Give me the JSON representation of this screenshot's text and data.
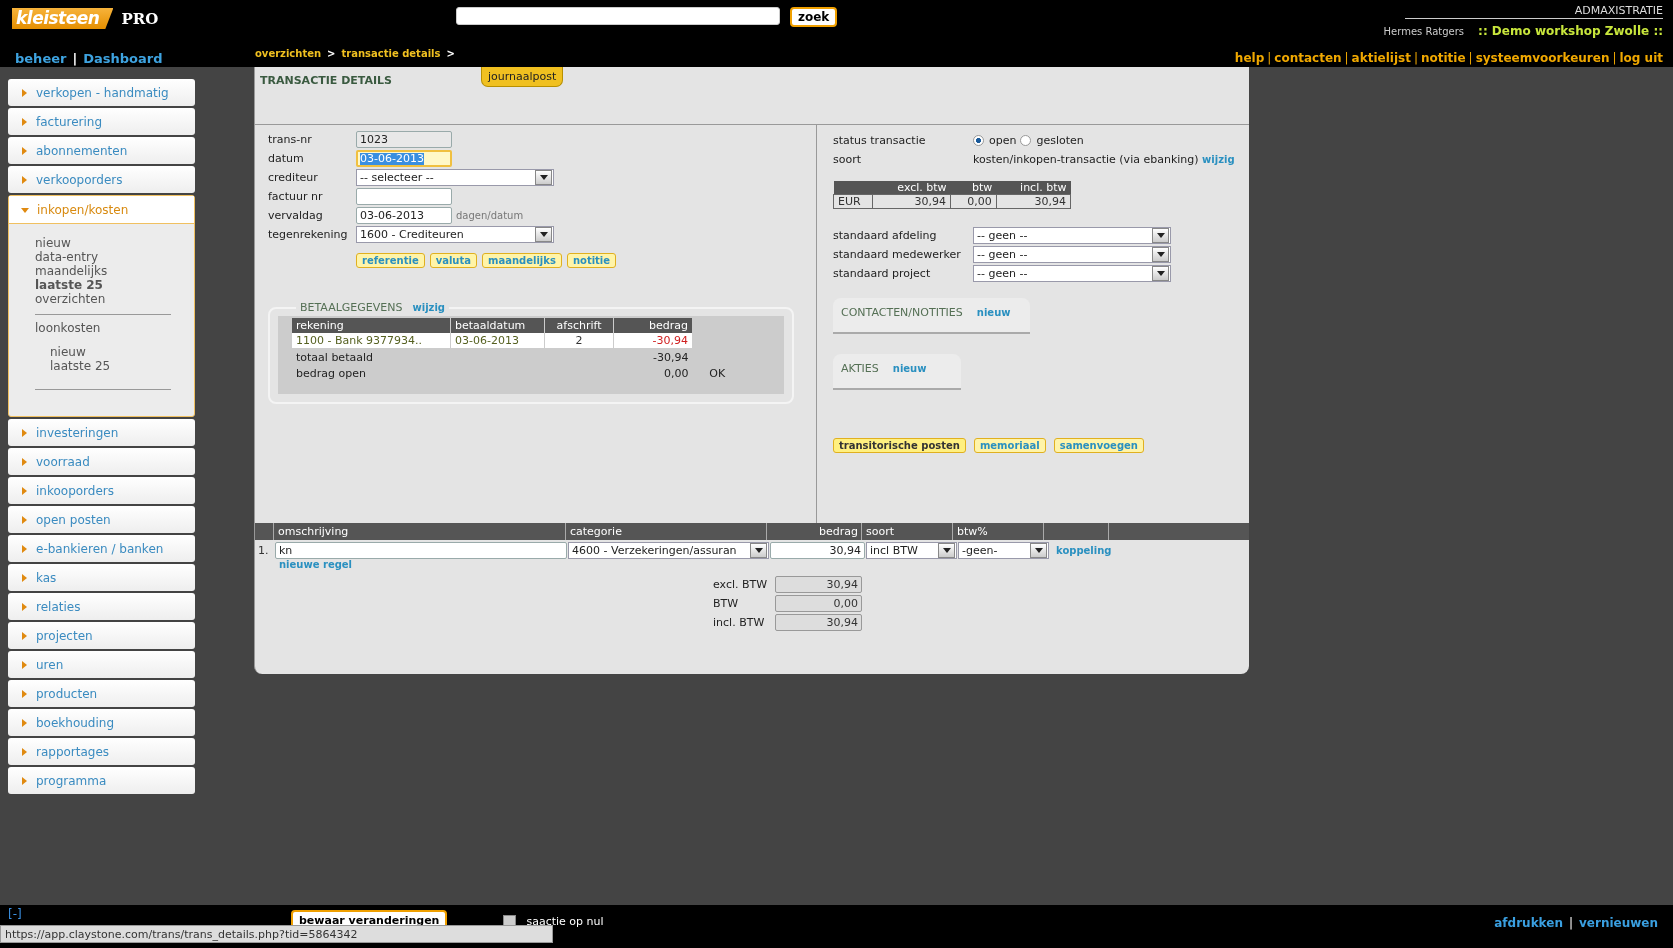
{
  "header": {
    "logo": "kleisteen",
    "edition": "PRO",
    "search": {
      "button": "zoek"
    },
    "app_name": "ADMAXISTRATIE",
    "user": "Hermes Ratgers",
    "company": ":: Demo workshop Zwolle ::",
    "left_links": [
      "beheer",
      "Dashboard"
    ],
    "link_separator": "|",
    "breadcrumb": [
      "overzichten",
      "transactie details"
    ],
    "breadcrumb_separator": ">",
    "top_links": [
      "help",
      "contacten",
      "aktielijst",
      "notitie",
      "systeemvoorkeuren",
      "log uit"
    ]
  },
  "sidebar": {
    "items": [
      {
        "label": "verkopen - handmatig",
        "expanded": false
      },
      {
        "label": "facturering",
        "expanded": false
      },
      {
        "label": "abonnementen",
        "expanded": false
      },
      {
        "label": "verkooporders",
        "expanded": false
      },
      {
        "label": "inkopen/kosten",
        "expanded": true,
        "children": [
          {
            "label": "nieuw",
            "selected": false
          },
          {
            "label": "data-entry",
            "selected": false
          },
          {
            "label": "maandelijks",
            "selected": false
          },
          {
            "label": "laatste 25",
            "selected": true
          },
          {
            "label": "overzichten",
            "selected": false
          },
          {
            "label": "loonkosten",
            "selected": false,
            "children": [
              {
                "label": "nieuw",
                "selected": false
              },
              {
                "label": "laatste 25",
                "selected": false
              }
            ]
          }
        ]
      },
      {
        "label": "investeringen",
        "expanded": false
      },
      {
        "label": "voorraad",
        "expanded": false
      },
      {
        "label": "inkooporders",
        "expanded": false
      },
      {
        "label": "open posten",
        "expanded": false
      },
      {
        "label": "e-bankieren / banken",
        "expanded": false
      },
      {
        "label": "kas",
        "expanded": false
      },
      {
        "label": "relaties",
        "expanded": false
      },
      {
        "label": "projecten",
        "expanded": false
      },
      {
        "label": "uren",
        "expanded": false
      },
      {
        "label": "producten",
        "expanded": false
      },
      {
        "label": "boekhouding",
        "expanded": false
      },
      {
        "label": "rapportages",
        "expanded": false
      },
      {
        "label": "programma",
        "expanded": false
      }
    ]
  },
  "main": {
    "title": "TRANSACTIE DETAILS",
    "tab": "journaalpost",
    "fields": [
      {
        "label": "trans-nr",
        "kind": "input",
        "value": "1023",
        "disabled": true,
        "focused": false
      },
      {
        "label": "datum",
        "kind": "input",
        "value": "03-06-2013",
        "disabled": false,
        "focused": true
      },
      {
        "label": "crediteur",
        "kind": "select",
        "value": "-- selecteer --",
        "disabled": false,
        "focused": false
      },
      {
        "label": "factuur nr",
        "kind": "input",
        "disabled": false,
        "focused": false
      },
      {
        "label": "vervaldag",
        "kind": "input",
        "value": "03-06-2013",
        "hint": "dagen/datum",
        "disabled": false,
        "focused": false
      },
      {
        "label": "tegenrekening",
        "kind": "select",
        "value": "1600 - Crediteuren",
        "disabled": false,
        "focused": false
      }
    ],
    "field_buttons": [
      "referentie",
      "valuta",
      "maandelijks",
      "notitie"
    ],
    "payment": {
      "title": "BETAALGEGEVENS",
      "link": "wijzig",
      "columns": [
        "rekening",
        "betaaldatum",
        "afschrift",
        "bedrag"
      ],
      "rows": [
        [
          "1100 - Bank 9377934..",
          "03-06-2013",
          "2",
          "-30,94"
        ]
      ],
      "totals": [
        {
          "label": "totaal betaald",
          "value": "-30,94"
        },
        {
          "label": "bedrag open",
          "value": "0,00",
          "status": "OK"
        }
      ]
    },
    "status": {
      "label": "status transactie",
      "options": [
        {
          "label": "open",
          "selected": true
        },
        {
          "label": "gesloten",
          "selected": false
        }
      ]
    },
    "soort": {
      "label": "soort",
      "value": "kosten/inkopen-transactie (via ebanking)",
      "link": "wijzig"
    },
    "amounts": {
      "columns": [
        "excl. btw",
        "btw",
        "incl. btw"
      ],
      "row": [
        "EUR",
        "30,94",
        "0,00",
        "30,94"
      ]
    },
    "defaults": [
      {
        "label": "standaard afdeling",
        "value": "-- geen --"
      },
      {
        "label": "standaard medewerker",
        "value": "-- geen --"
      },
      {
        "label": "standaard project",
        "value": "-- geen --"
      }
    ],
    "panels": [
      {
        "title": "CONTACTEN/NOTITIES",
        "link": "nieuw"
      },
      {
        "title": "AKTIES",
        "link": "nieuw"
      }
    ],
    "actions": [
      {
        "label": "transitorische posten",
        "active": true
      },
      {
        "label": "memoriaal",
        "active": false
      },
      {
        "label": "samenvoegen",
        "active": false
      }
    ],
    "lines": {
      "columns": [
        "omschrijving",
        "categorie",
        "bedrag",
        "soort",
        "btw%"
      ],
      "rows": [
        {
          "number": "1.",
          "omschrijving": "kn",
          "categorie": "4600 - Verzekeringen/assuran",
          "bedrag": "30,94",
          "soort": "incl BTW",
          "btw": "-geen-",
          "link": "koppeling"
        }
      ],
      "add_link": "nieuwe regel",
      "totals": [
        {
          "label": "excl. BTW",
          "value": "30,94"
        },
        {
          "label": "BTW",
          "value": "0,00"
        },
        {
          "label": "incl. BTW",
          "value": "30,94"
        }
      ]
    }
  },
  "footer": {
    "toggle": "[-]",
    "save_button": "bewaar veranderingen",
    "checkbox": {
      "label": "saactie op nul",
      "checked": false
    },
    "links": [
      "afdrukken",
      "vernieuwen"
    ],
    "status_url": "https://app.claystone.com/trans/trans_details.php?tid=5864342"
  }
}
